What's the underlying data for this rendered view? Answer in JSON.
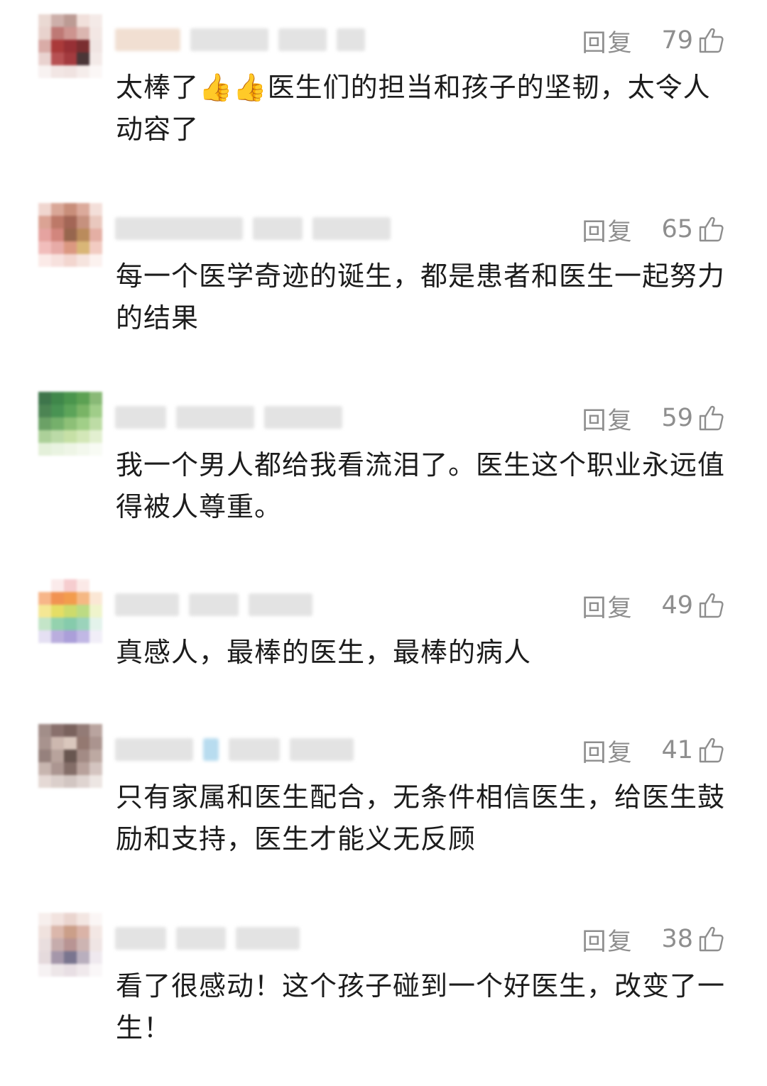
{
  "comments": [
    {
      "reply_label": "回复",
      "likes": "79",
      "text": "太棒了👍👍医生们的担当和孩子的坚韧，太令人动容了",
      "avatar_colors": [
        "#e9d6d0",
        "#c9a9a3",
        "#b7938c",
        "#f0ded8",
        "#f4e9e6",
        "#e7cfc9",
        "#b96e6a",
        "#c98b86",
        "#d8b0aa",
        "#f2e6e2",
        "#d6a5a0",
        "#a32a2a",
        "#8f1f24",
        "#6f1d1f",
        "#efe3e1",
        "#e8cfcc",
        "#b14345",
        "#9c2b2f",
        "#3b2527",
        "#f3e9e7",
        "#f8f1f0",
        "#f1e4e2",
        "#efe1df",
        "#f5ecea",
        "#fbf7f6"
      ]
    },
    {
      "reply_label": "回复",
      "likes": "65",
      "text": "每一个医学奇迹的诞生，都是患者和医生一起努力的结果",
      "avatar_colors": [
        "#efd3cc",
        "#d6a08f",
        "#c4856f",
        "#d9a393",
        "#f3ddd6",
        "#d89c8c",
        "#b86e5c",
        "#9c5a48",
        "#c28874",
        "#e8c4b9",
        "#e39c98",
        "#cf7c72",
        "#8f5a3f",
        "#b5824f",
        "#e2a99d",
        "#f0b8b6",
        "#e6a4a0",
        "#d99077",
        "#d6b06c",
        "#f1c7bd",
        "#fbe9e6",
        "#f7dfdb",
        "#f2d3cc",
        "#f6e2dc",
        "#fcf1ee"
      ]
    },
    {
      "reply_label": "回复",
      "likes": "59",
      "text": "我一个男人都给我看流泪了。医生这个职业永远值得被人尊重。",
      "avatar_colors": [
        "#2e6a3c",
        "#2f7d3b",
        "#3b8d3e",
        "#4f9a45",
        "#7fb46b",
        "#3d7a45",
        "#3a8a45",
        "#4f9d4c",
        "#6eae59",
        "#98c97f",
        "#5f9a5a",
        "#6aaa5f",
        "#84bb6c",
        "#9acb7e",
        "#b8da9e",
        "#a6cd91",
        "#b6d7a0",
        "#c2de9f",
        "#d0e6b2",
        "#e0eecd",
        "#e2efd7",
        "#e8f3df",
        "#edf5e4",
        "#f2f8ec",
        "#f8fbf4"
      ]
    },
    {
      "reply_label": "回复",
      "likes": "49",
      "text": "真感人，最棒的医生，最棒的病人",
      "avatar_colors": [
        "#ffffff",
        "#fbeaea",
        "#f6c9cc",
        "#fbe8e6",
        "#ffffff",
        "#f7b080",
        "#f08a44",
        "#f2943e",
        "#f5b37a",
        "#fbe6d2",
        "#f4e58c",
        "#e3dc58",
        "#c9d860",
        "#b7d87a",
        "#eef4c8",
        "#bfe3c4",
        "#8ccfa8",
        "#7cc7a6",
        "#93d0b6",
        "#e1f2ea",
        "#e3def2",
        "#b5a8dc",
        "#a497d6",
        "#bcb2e3",
        "#f0edf8"
      ]
    },
    {
      "reply_label": "回复",
      "likes": "41",
      "text": "只有家属和医生配合，无条件相信医生，给医生鼓励和支持，医生才能义无反顾",
      "avatar_colors": [
        "#9b8580",
        "#7f6460",
        "#6f5550",
        "#8a706b",
        "#b49d97",
        "#a18a85",
        "#c9b2a9",
        "#d7c3b8",
        "#8c6e66",
        "#a48c86",
        "#8e7772",
        "#b29c94",
        "#5c4842",
        "#9c827b",
        "#b8a29b",
        "#c3afa9",
        "#a58e88",
        "#7a625c",
        "#b29a93",
        "#d1c0bb",
        "#e3d6d2",
        "#d9ccc7",
        "#cfc2bd",
        "#ddd1cd",
        "#ece4e1"
      ]
    },
    {
      "reply_label": "回复",
      "likes": "38",
      "text": "看了很感动！这个孩子碰到一个好医生，改变了一生！",
      "avatar_colors": [
        "#f7eeec",
        "#f1e1dd",
        "#e9d2cc",
        "#f2e4e0",
        "#fbf6f5",
        "#efe0dc",
        "#d8b1a4",
        "#c7977f",
        "#d7ada0",
        "#f3e6e2",
        "#e8dcdc",
        "#c2a6a6",
        "#b38b8a",
        "#c9aeac",
        "#eee3e2",
        "#e3d7da",
        "#9e8fa3",
        "#6f6a86",
        "#b4a9b9",
        "#eee8ee",
        "#f6f1f2",
        "#ece4e7",
        "#e7dde2",
        "#efe8eb",
        "#faf7f8"
      ]
    }
  ]
}
